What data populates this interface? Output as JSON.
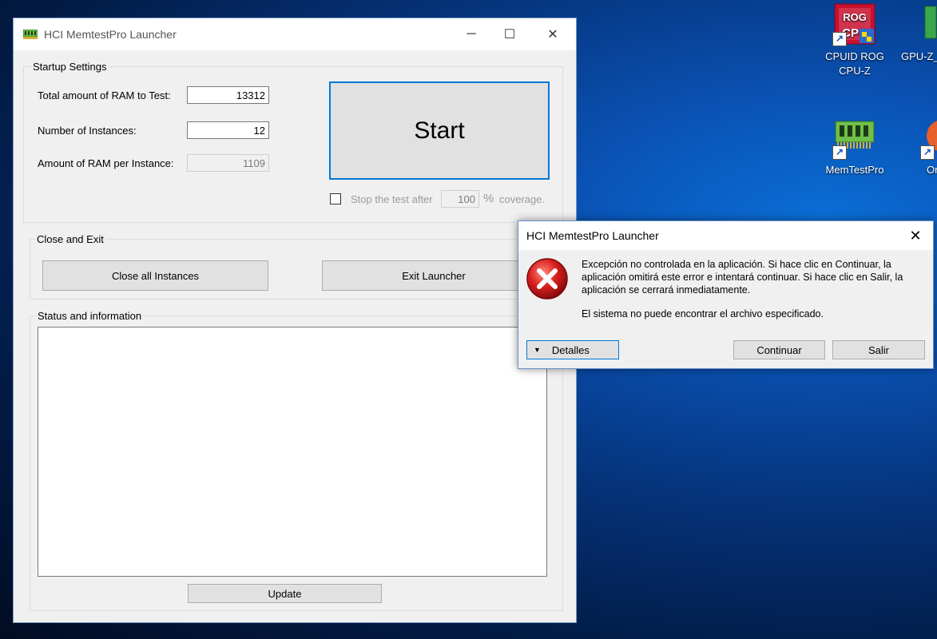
{
  "desktop": {
    "icons": [
      {
        "label_line1": "CPUID ROG",
        "label_line2": "CPU-Z",
        "art": "ROG",
        "art2": "CPU"
      },
      {
        "label_line1": "GPU-Z_",
        "label_line2": ""
      },
      {
        "label_line1": "MemTestPro",
        "label_line2": ""
      },
      {
        "label_line1": "Or",
        "label_line2": ""
      }
    ]
  },
  "window": {
    "title": "HCI MemtestPro Launcher",
    "controls": {
      "minimize": "─",
      "maximize": "☐",
      "close": "✕"
    },
    "startup": {
      "group_label": "Startup Settings",
      "total_ram_label": "Total amount of RAM to Test:",
      "total_ram_value": "13312",
      "instances_label": "Number of Instances:",
      "instances_value": "12",
      "ram_per_instance_label": "Amount of RAM per Instance:",
      "ram_per_instance_value": "1109",
      "start_label": "Start",
      "stop_label": "Stop the test after",
      "coverage_value": "100",
      "percent": "%",
      "coverage_label": "coverage."
    },
    "close_exit": {
      "group_label": "Close and Exit",
      "close_all_label": "Close all Instances",
      "exit_label": "Exit Launcher"
    },
    "status": {
      "group_label": "Status and information",
      "text": "",
      "update_label": "Update"
    }
  },
  "dialog": {
    "title": "HCI MemtestPro Launcher",
    "close": "✕",
    "message_line1": "Excepción no controlada en la aplicación. Si hace clic en Continuar, la",
    "message_line2": "aplicación omitirá este error e intentará continuar. Si hace clic en Salir, la",
    "message_line3": "aplicación se cerrará inmediatamente.",
    "detail": "El sistema no puede encontrar el archivo especificado.",
    "details_label": "Detalles",
    "details_arrow": "▼",
    "continue_label": "Continuar",
    "exit_label": "Salir"
  }
}
